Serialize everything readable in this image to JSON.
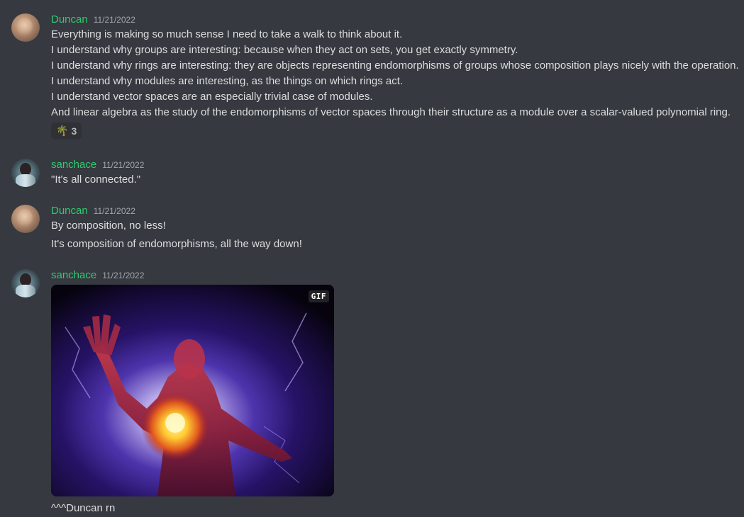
{
  "messages": [
    {
      "author": "Duncan",
      "timestamp": "11/21/2022",
      "lines": [
        "Everything is making so much sense I need to take a walk to think about it.",
        "I understand why groups are interesting: because when they act on sets, you get exactly symmetry.",
        "I understand why rings are interesting: they are objects representing endomorphisms of groups whose composition plays nicely with the operation.",
        "I understand why modules are interesting, as the things on which rings act.",
        "I understand vector spaces are an especially trivial case of modules.",
        "And linear algebra as the study of the endomorphisms of vector spaces through their structure as a module over a scalar-valued polynomial ring."
      ],
      "reaction": {
        "emoji": "🌴",
        "count": "3"
      }
    },
    {
      "author": "sanchace",
      "timestamp": "11/21/2022",
      "lines": [
        "\"It's all connected.\""
      ]
    },
    {
      "author": "Duncan",
      "timestamp": "11/21/2022",
      "lines": [
        "By composition, no less!",
        "It's composition of endomorphisms, all the way down!"
      ]
    },
    {
      "author": "sanchace",
      "timestamp": "11/21/2022",
      "gif_badge": "GIF",
      "lines": [
        "^^^Duncan rn"
      ]
    }
  ],
  "colors": {
    "background": "#36393f",
    "username": "#2ecc71",
    "timestamp": "#a3a6aa",
    "text": "#dcddde"
  }
}
